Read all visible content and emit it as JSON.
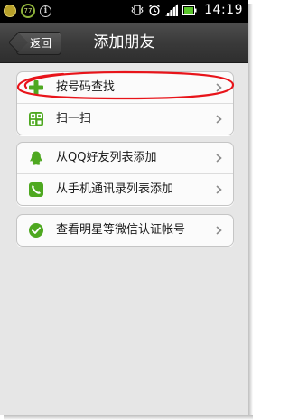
{
  "status_bar": {
    "badge_number": "77",
    "info_glyph": "i",
    "time": "14:19",
    "icons": [
      "app-icon",
      "notification-badge-icon",
      "info-icon",
      "vibrate-icon",
      "alarm-icon",
      "signal-icon",
      "battery-icon"
    ]
  },
  "header": {
    "back_label": "返回",
    "title": "添加朋友"
  },
  "groups": [
    {
      "items": [
        {
          "label": "按号码查找",
          "icon": "plus-icon"
        },
        {
          "label": "扫一扫",
          "icon": "qr-scan-icon"
        }
      ]
    },
    {
      "items": [
        {
          "label": "从QQ好友列表添加",
          "icon": "qq-penguin-icon"
        },
        {
          "label": "从手机通讯录列表添加",
          "icon": "phone-contacts-icon"
        }
      ]
    },
    {
      "items": [
        {
          "label": "查看明星等微信认证帐号",
          "icon": "verified-check-icon"
        }
      ]
    }
  ],
  "colors": {
    "accent_green": "#4ea820",
    "highlight_red": "#e8141a",
    "title_bar": "#3a3a3a",
    "page_background": "#e6e6e6"
  }
}
